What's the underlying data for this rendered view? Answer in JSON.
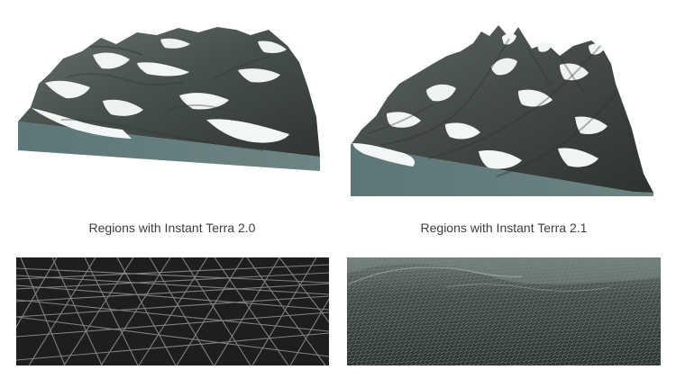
{
  "captions": {
    "left": "Regions with Instant Terra 2.0",
    "right": "Regions with Instant Terra 2.1"
  },
  "colors": {
    "page_background": "#ffffff",
    "caption_text": "#3d3d3d",
    "terrain_rock": "#4d5350",
    "terrain_snow": "#f3f6f7",
    "terrain_side": "#5f7879",
    "mesh_background_left": "#1e1e1e",
    "mesh_background_right": "#27302f",
    "mesh_line": "#8c8c8c"
  }
}
